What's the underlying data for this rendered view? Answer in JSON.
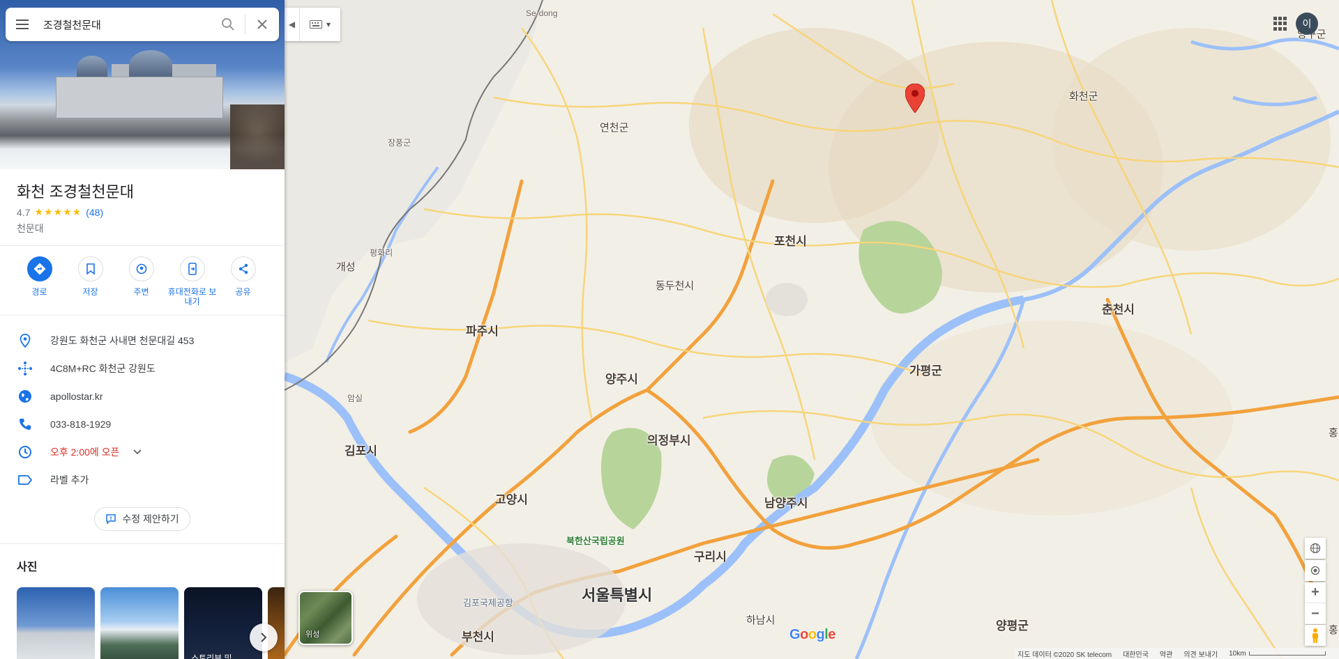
{
  "search": {
    "query": "조경철천문대"
  },
  "place": {
    "name": "화천 조경철천문대",
    "rating": "4.7",
    "stars": "★★★★★",
    "review_count": "(48)",
    "category": "천문대"
  },
  "actions": [
    {
      "label": "경로",
      "icon": "directions-icon"
    },
    {
      "label": "저장",
      "icon": "bookmark-icon"
    },
    {
      "label": "주변",
      "icon": "nearby-icon"
    },
    {
      "label": "휴대전화로 보내기",
      "icon": "send-to-phone-icon"
    },
    {
      "label": "공유",
      "icon": "share-icon"
    }
  ],
  "info": {
    "address": "강원도 화천군 사내면 천문대길 453",
    "plus_code": "4C8M+RC 화천군 강원도",
    "website": "apollostar.kr",
    "phone": "033-818-1929",
    "hours": "오후 2:00에 오픈",
    "label": "라벨 추가"
  },
  "suggest_edit": "수정 제안하기",
  "photos": {
    "title": "사진",
    "thumb3_caption": "스토리뷰 및"
  },
  "map": {
    "avatar_initial": "이",
    "satellite_label": "위성",
    "google": "Google",
    "footer": {
      "data": "지도 데이터 ©2020 SK telecom",
      "country": "대한민국",
      "terms": "약관",
      "feedback": "의견 보내기",
      "scale": "10km"
    },
    "places": [
      {
        "name": "Se-dong",
        "cls": "small"
      },
      {
        "name": "연천군",
        "cls": "county"
      },
      {
        "name": "장풍군",
        "cls": "small"
      },
      {
        "name": "평화리",
        "cls": "small"
      },
      {
        "name": "개성",
        "cls": "county"
      },
      {
        "name": "화천군",
        "cls": "county"
      },
      {
        "name": "포천시",
        "cls": "city"
      },
      {
        "name": "동두천시",
        "cls": "county"
      },
      {
        "name": "파주시",
        "cls": "city"
      },
      {
        "name": "춘천시",
        "cls": "city"
      },
      {
        "name": "가평군",
        "cls": "city"
      },
      {
        "name": "양주시",
        "cls": "city"
      },
      {
        "name": "암실",
        "cls": "small"
      },
      {
        "name": "김포시",
        "cls": "city"
      },
      {
        "name": "의정부시",
        "cls": "city"
      },
      {
        "name": "고양시",
        "cls": "city"
      },
      {
        "name": "남양주시",
        "cls": "city"
      },
      {
        "name": "북한산국립공원",
        "cls": "park"
      },
      {
        "name": "구리시",
        "cls": "city"
      },
      {
        "name": "서울특별시",
        "cls": "big"
      },
      {
        "name": "김포국제공항",
        "cls": "airport"
      },
      {
        "name": "하남시",
        "cls": "county"
      },
      {
        "name": "부천시",
        "cls": "city"
      },
      {
        "name": "양평군",
        "cls": "city"
      },
      {
        "name": "양구군",
        "cls": "county"
      },
      {
        "name": "홍",
        "cls": "county"
      },
      {
        "name": "홍",
        "cls": "county"
      }
    ]
  }
}
